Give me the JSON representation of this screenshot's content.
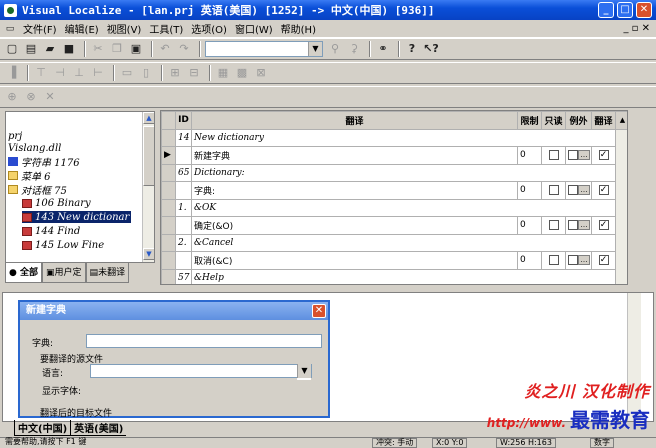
{
  "window": {
    "title": "Visual Localize - [lan.prj 英语(美国) [1252] -> 中文(中国) [936]]"
  },
  "menu": [
    "文件(F)",
    "编辑(E)",
    "视图(V)",
    "工具(T)",
    "选项(O)",
    "窗口(W)",
    "帮助(H)"
  ],
  "tree": {
    "items": [
      {
        "label": "prj",
        "icon": "none"
      },
      {
        "label": "Vislang.dll",
        "icon": "none"
      },
      {
        "label": "字符串 1176",
        "icon": "folder-icon"
      },
      {
        "label": "菜单 6",
        "icon": "folder-icon"
      },
      {
        "label": "对话框 75",
        "icon": "folder-icon"
      },
      {
        "label": "106 Binary",
        "icon": "resource-icon"
      },
      {
        "label": "143 New dictionar",
        "icon": "resource-icon",
        "selected": true
      },
      {
        "label": "144 Find",
        "icon": "resource-icon"
      },
      {
        "label": "145 Low Fine",
        "icon": "resource-icon"
      }
    ],
    "tabs": [
      "全部",
      "用户定",
      "未翻译"
    ]
  },
  "grid": {
    "headers": [
      "ID",
      "翻译",
      "限制",
      "只读",
      "例外",
      "翻译"
    ],
    "rows": [
      {
        "id": "14",
        "source": "New dictionary",
        "translation": "新建字典",
        "limit": "0",
        "readonly": false,
        "exception": false,
        "translated": true,
        "current": true
      },
      {
        "id": "65",
        "source": "Dictionary:",
        "translation": "字典:",
        "limit": "0",
        "readonly": false,
        "exception": false,
        "translated": true,
        "current": false
      },
      {
        "id": "1.",
        "source": "&OK",
        "translation": "确定(&O)",
        "limit": "0",
        "readonly": false,
        "exception": false,
        "translated": true,
        "current": false
      },
      {
        "id": "2.",
        "source": "&Cancel",
        "translation": "取消(&C)",
        "limit": "0",
        "readonly": false,
        "exception": false,
        "translated": true,
        "current": false
      },
      {
        "id": "57",
        "source": "&Help",
        "translation": "",
        "limit": "",
        "readonly": false,
        "exception": false,
        "translated": false,
        "current": false
      }
    ]
  },
  "dialog": {
    "title": "新建字典",
    "dictionary_label": "字典:",
    "group_source": "要翻译的源文件",
    "language_label": "语言:",
    "font_label": "显示字体:",
    "group_target": "翻译后的目标文件"
  },
  "bottom_tabs": [
    "中文(中国)",
    "英语(美国)"
  ],
  "status": {
    "help": "需要帮助,请按下 F1 键",
    "conflict": "冲突: 手动",
    "pos": "X:0 Y:0",
    "size": "W:256 H:163",
    "mode": "数字"
  },
  "watermark": {
    "line1": "炎之川 汉化制作",
    "url": "http://www.",
    "line2": "最需教育"
  }
}
